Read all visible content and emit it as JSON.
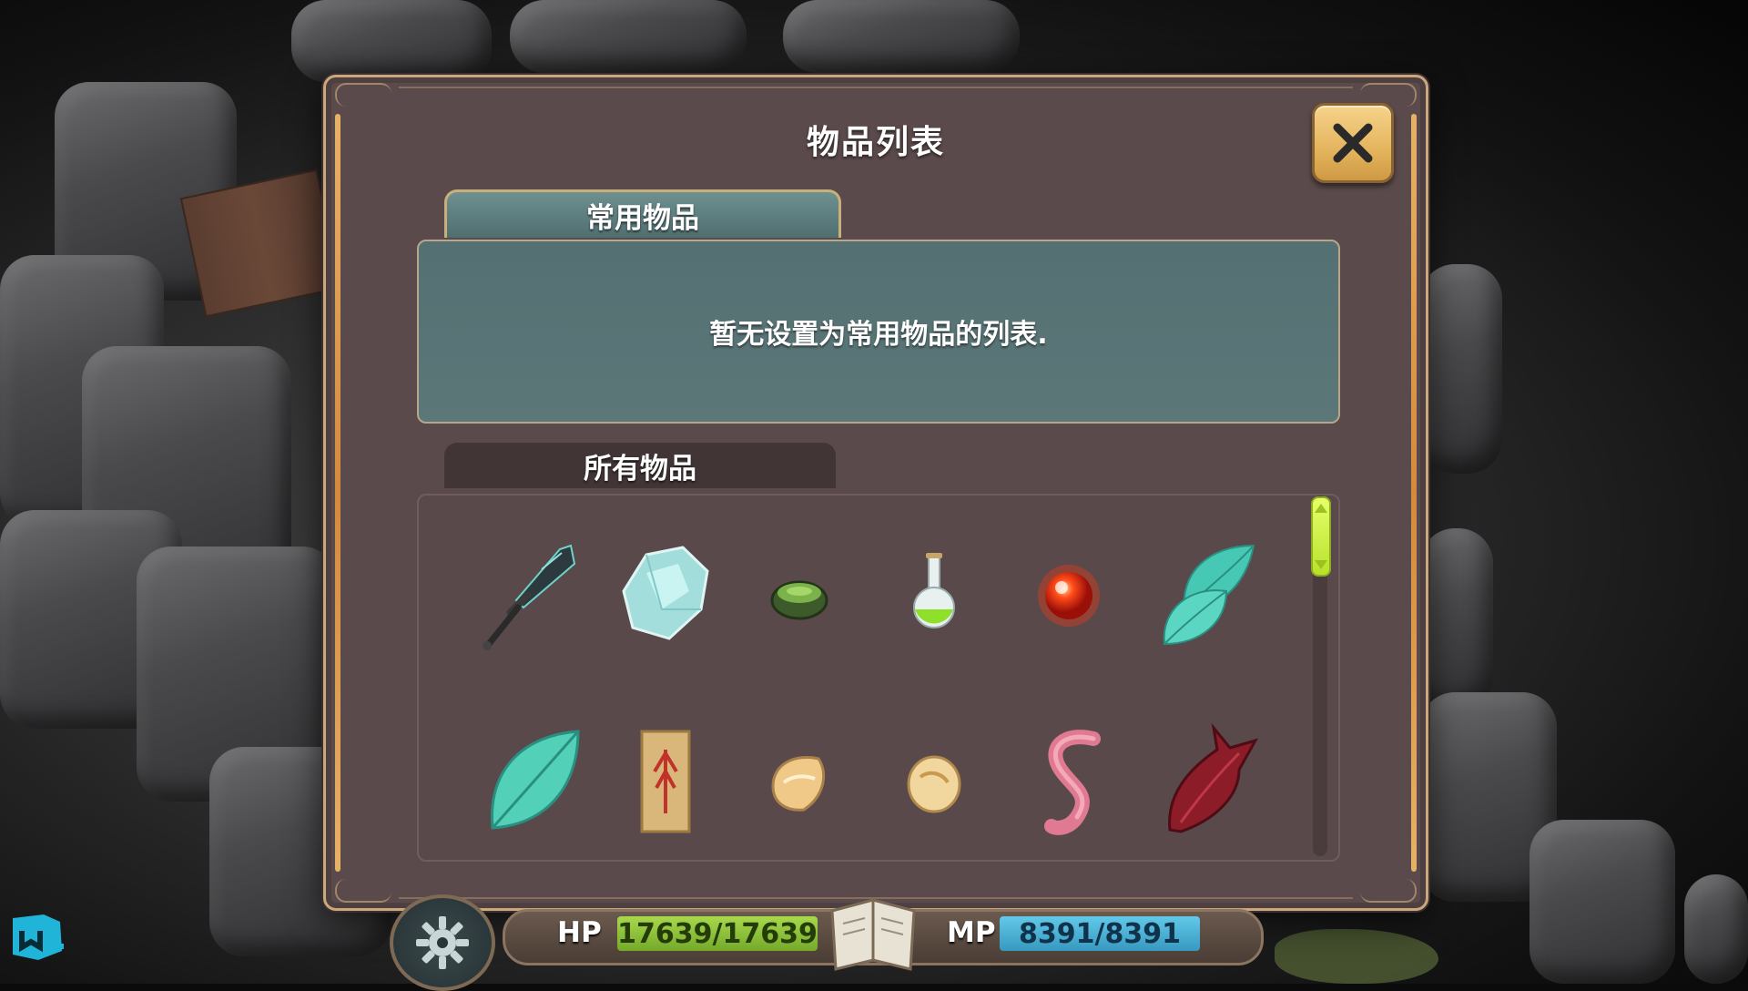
{
  "dialog": {
    "title": "物品列表",
    "close_icon": "close-icon",
    "tab_favorite": "常用物品",
    "favorite_empty_message": "暂无设置为常用物品的列表.",
    "tab_all": "所有物品"
  },
  "items": [
    {
      "icon": "dark-sword-icon"
    },
    {
      "icon": "ice-crystal-icon"
    },
    {
      "icon": "green-bowl-icon"
    },
    {
      "icon": "green-potion-flask-icon"
    },
    {
      "icon": "red-orb-icon"
    },
    {
      "icon": "teal-leaves-icon"
    },
    {
      "icon": "teal-leaf-icon"
    },
    {
      "icon": "rune-scroll-icon"
    },
    {
      "icon": "shell-fragment-icon"
    },
    {
      "icon": "egg-stone-icon"
    },
    {
      "icon": "pink-worm-icon"
    },
    {
      "icon": "red-wing-icon"
    }
  ],
  "hud": {
    "hp_label": "HP",
    "hp_value": "17639/17639",
    "hp_fraction": 1.0,
    "mp_label": "MP",
    "mp_value": "8391/8391",
    "mp_fraction": 1.0,
    "gear_icon": "gear-icon",
    "book_icon": "spellbook-icon"
  },
  "colors": {
    "dialog_bg": "#5b4a4b",
    "accent_gold": "#e4b45d",
    "favorite_panel": "#547072",
    "hp_bar": "#a8d84c",
    "mp_bar": "#62c9e8",
    "scroll_thumb": "#d6f744"
  }
}
